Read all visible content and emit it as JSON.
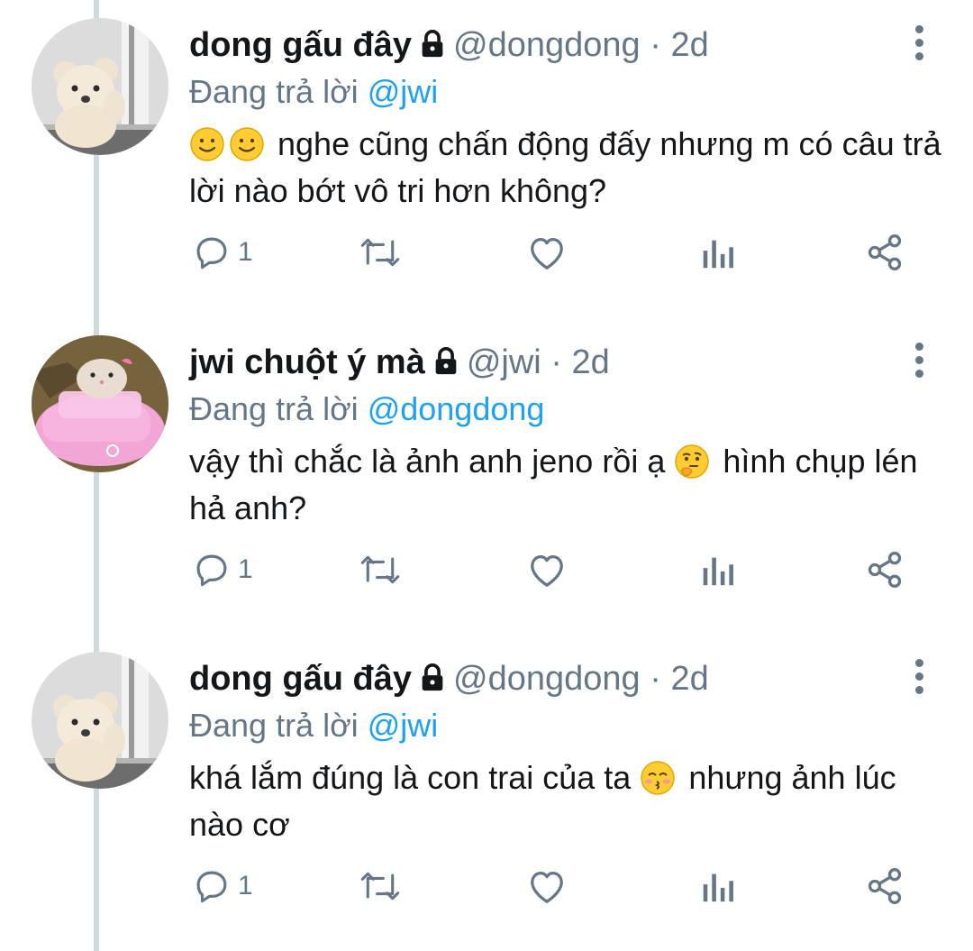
{
  "tweets": [
    {
      "name": "dong gấu đây",
      "handle": "@dongdong",
      "sep": " · ",
      "time": "2d",
      "reply_prefix": "Đang trả lời ",
      "reply_to": "@jwi",
      "text": "nghe cũng chấn động đấy nhưng m có câu trả lời nào bớt vô tri hơn không?",
      "emoji_before": [
        "slightly-smiling-face",
        "slightly-smiling-face"
      ],
      "reply_count": "1",
      "avatar": "teddy-bear-avatar"
    },
    {
      "name": "jwi chuột ý mà",
      "handle": "@jwi",
      "sep": " · ",
      "time": "2d",
      "reply_prefix": "Đang trả lời ",
      "reply_to": "@dongdong",
      "text_a": "vậy thì chắc là ảnh anh jeno rồi ạ",
      "emoji_mid": "thinking-face",
      "text_b": "hình chụp lén hả anh?",
      "reply_count": "1",
      "avatar": "hamster-pink-car-avatar"
    },
    {
      "name": "dong gấu đây",
      "handle": "@dongdong",
      "sep": " · ",
      "time": "2d",
      "reply_prefix": "Đang trả lời ",
      "reply_to": "@jwi",
      "text_a": "khá lắm đúng là con trai của ta",
      "emoji_mid": "kissing-face",
      "text_b": "nhưng ảnh lúc nào cơ",
      "reply_count": "1",
      "avatar": "teddy-bear-avatar"
    }
  ],
  "colors": {
    "accent": "#1da1f2",
    "muted": "#657786",
    "text": "#14171a",
    "line": "#cfd9de"
  }
}
